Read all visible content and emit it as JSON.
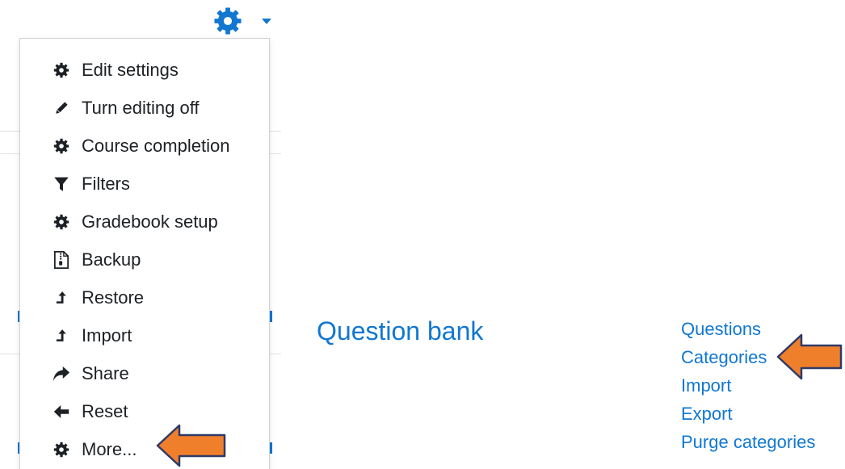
{
  "settings_menu": {
    "items": [
      {
        "label": "Edit settings",
        "icon": "gear-icon"
      },
      {
        "label": "Turn editing off",
        "icon": "pencil-icon"
      },
      {
        "label": "Course completion",
        "icon": "gear-icon"
      },
      {
        "label": "Filters",
        "icon": "filter-icon"
      },
      {
        "label": "Gradebook setup",
        "icon": "gear-icon"
      },
      {
        "label": "Backup",
        "icon": "file-archive-icon"
      },
      {
        "label": "Restore",
        "icon": "upload-icon"
      },
      {
        "label": "Import",
        "icon": "upload-icon"
      },
      {
        "label": "Share",
        "icon": "share-icon"
      },
      {
        "label": "Reset",
        "icon": "arrow-left-icon"
      },
      {
        "label": "More...",
        "icon": "gear-icon"
      }
    ]
  },
  "question_bank": {
    "title": "Question bank",
    "links": [
      {
        "label": "Questions"
      },
      {
        "label": "Categories"
      },
      {
        "label": "Import"
      },
      {
        "label": "Export"
      },
      {
        "label": "Purge categories"
      }
    ]
  },
  "colors": {
    "link": "#1177d1",
    "menu_text": "#1d2125",
    "annotation_arrow_fill": "#f07f2c",
    "annotation_arrow_stroke": "#2f3a66"
  }
}
